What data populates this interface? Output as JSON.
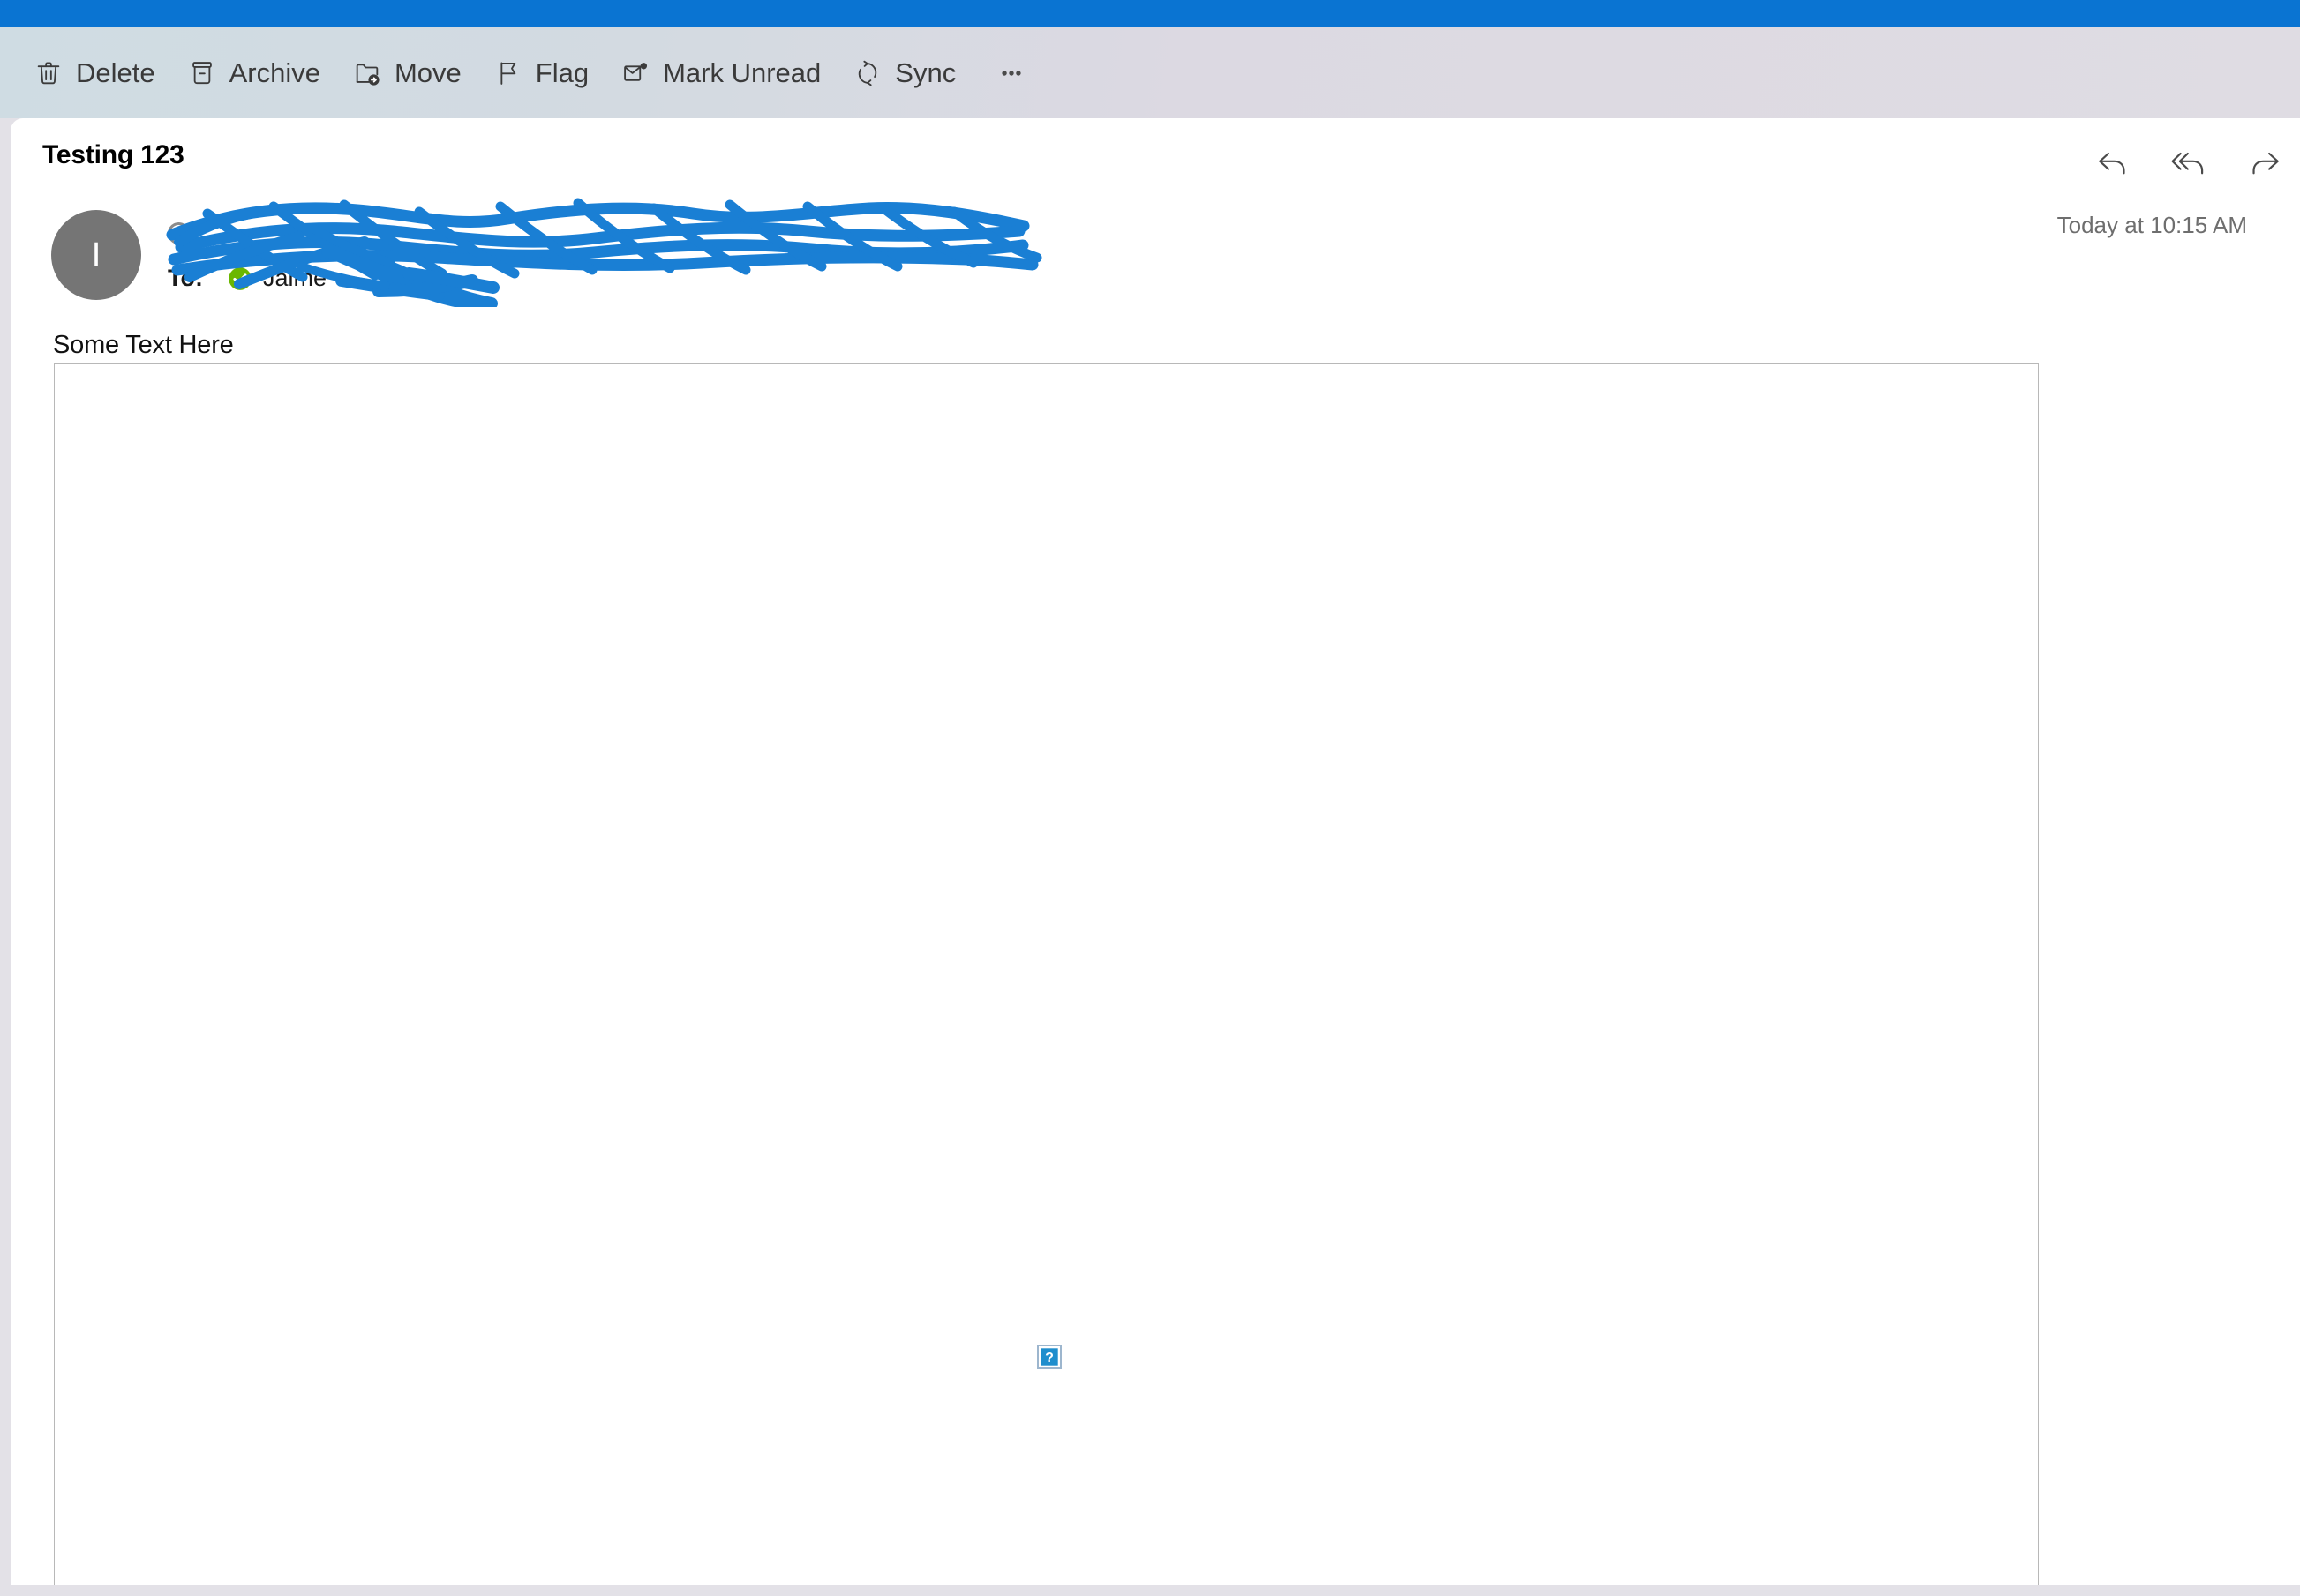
{
  "window": {
    "accent_color": "#0a74d2",
    "toolbar_gradient_start": "#cfdce3",
    "toolbar_gradient_end": "#dfdce3"
  },
  "toolbar": {
    "buttons": [
      {
        "label": "Delete",
        "icon": "trash-icon"
      },
      {
        "label": "Archive",
        "icon": "archive-box-icon"
      },
      {
        "label": "Move",
        "icon": "folder-arrow-icon"
      },
      {
        "label": "Flag",
        "icon": "flag-icon"
      },
      {
        "label": "Mark Unread",
        "icon": "envelope-dot-icon"
      },
      {
        "label": "Sync",
        "icon": "refresh-circle-icon"
      }
    ],
    "overflow": {
      "label": "More options",
      "icon": "ellipsis-icon"
    }
  },
  "message": {
    "subject": "Testing 123",
    "timestamp": "Today at 10:15 AM",
    "avatar_initial": "I",
    "avatar_color": "#757575",
    "sender_name_redacted": true,
    "sender_name": "",
    "recipient_label": "To:",
    "recipient_name": "Jaime",
    "recipient_verified": true,
    "recipient_verified_color": "#6bb700",
    "body_text": "Some Text Here",
    "redaction_color": "#1a7fd4"
  },
  "header_actions": [
    {
      "name": "reply",
      "label": "Reply",
      "icon": "reply-arrow-icon"
    },
    {
      "name": "reply-all",
      "label": "Reply All",
      "icon": "reply-all-arrow-icon"
    },
    {
      "name": "forward",
      "label": "Forward",
      "icon": "forward-arrow-icon"
    }
  ],
  "content": {
    "broken_image_icon": "broken-image-placeholder-icon",
    "broken_image_glyph": "?",
    "broken_image_color": "#1f8ecd"
  }
}
